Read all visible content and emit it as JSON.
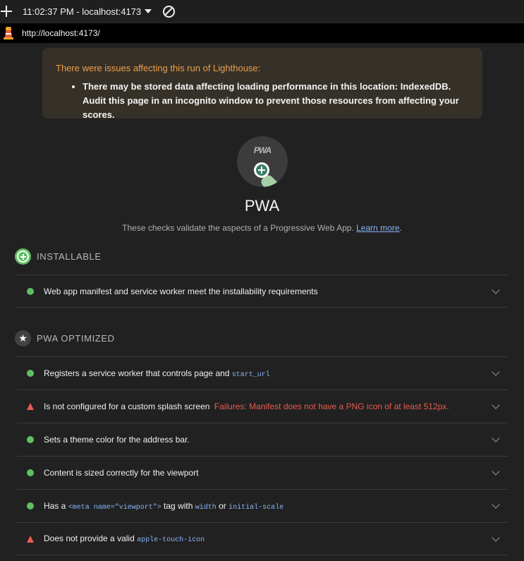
{
  "browser": {
    "tab_title": "11:02:37 PM - localhost:4173",
    "url": "http://localhost:4173/"
  },
  "warning": {
    "title": "There were issues affecting this run of Lighthouse:",
    "item": "There may be stored data affecting loading performance in this location: IndexedDB. Audit this page in an incognito window to prevent those resources from affecting your scores."
  },
  "category": {
    "gauge_label": "PWA",
    "title": "PWA",
    "description": "These checks validate the aspects of a Progressive Web App.",
    "learn_more": "Learn more",
    "period": "."
  },
  "groups": {
    "installable": {
      "label": "INSTALLABLE",
      "audits": [
        {
          "status": "pass",
          "text": "Web app manifest and service worker meet the installability requirements"
        }
      ]
    },
    "optimized": {
      "label": "PWA OPTIMIZED",
      "audits": [
        {
          "status": "pass",
          "text": "Registers a service worker that controls page and ",
          "code": "start_url"
        },
        {
          "status": "fail",
          "text": "Is not configured for a custom splash screen",
          "failure": "Failures: Manifest does not have a PNG icon of at least 512px."
        },
        {
          "status": "pass",
          "text": "Sets a theme color for the address bar."
        },
        {
          "status": "pass",
          "text": "Content is sized correctly for the viewport"
        },
        {
          "status": "pass",
          "text_a": "Has a ",
          "code_a": "<meta name=\"viewport\">",
          "text_b": " tag with ",
          "code_b": "width",
          "text_c": " or ",
          "code_c": "initial-scale"
        },
        {
          "status": "fail",
          "text": "Does not provide a valid ",
          "code": "apple-touch-icon"
        }
      ]
    }
  },
  "colors": {
    "pass": "#5fbf64",
    "fail": "#e65c4f",
    "warning_text": "#ee9e4a",
    "link": "#8ab4f8"
  }
}
